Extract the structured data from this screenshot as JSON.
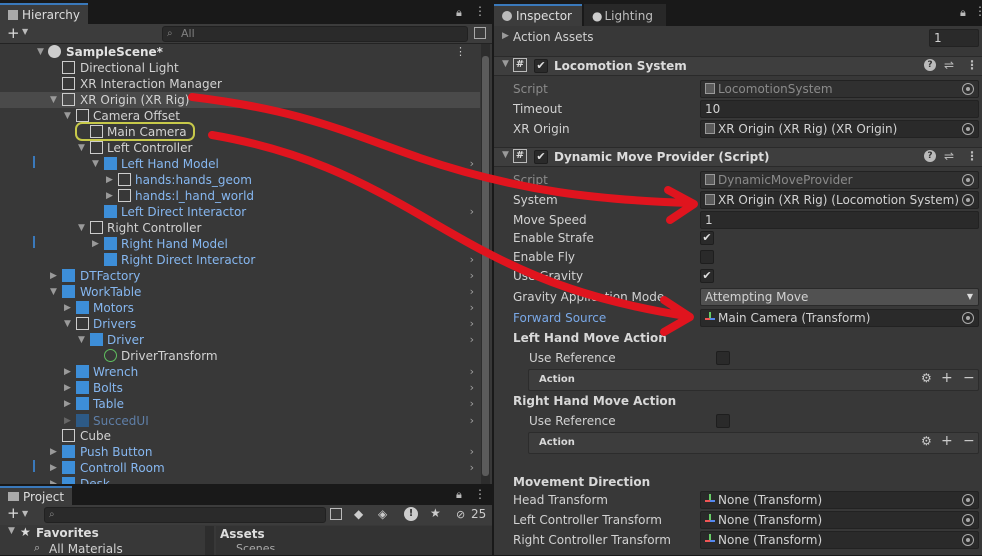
{
  "hierarchy": {
    "tab_label": "Hierarchy",
    "search_placeholder": "All",
    "add_label": "+",
    "items": [
      {
        "label": "SampleScene*",
        "depth": 0,
        "bold": true
      },
      {
        "label": "Directional Light"
      },
      {
        "label": "XR Interaction Manager"
      },
      {
        "label": "XR Origin (XR Rig)"
      },
      {
        "label": "Camera Offset"
      },
      {
        "label": "Main Camera"
      },
      {
        "label": "Left Controller"
      },
      {
        "label": "Left Hand Model"
      },
      {
        "label": "hands:hands_geom"
      },
      {
        "label": "hands:l_hand_world"
      },
      {
        "label": "Left Direct Interactor"
      },
      {
        "label": "Right Controller"
      },
      {
        "label": "Right Hand Model"
      },
      {
        "label": "Right Direct Interactor"
      },
      {
        "label": "DTFactory"
      },
      {
        "label": "WorkTable"
      },
      {
        "label": "Motors"
      },
      {
        "label": "Drivers"
      },
      {
        "label": "Driver"
      },
      {
        "label": "DriverTransform"
      },
      {
        "label": "Wrench"
      },
      {
        "label": "Bolts"
      },
      {
        "label": "Table"
      },
      {
        "label": "SuccedUI"
      },
      {
        "label": "Cube"
      },
      {
        "label": "Push Button"
      },
      {
        "label": "Controll Room"
      },
      {
        "label": "Desk"
      }
    ]
  },
  "project": {
    "tab_label": "Project",
    "add_label": "+",
    "hidden_count": "25",
    "favorites_label": "Favorites",
    "all_materials": "All Materials",
    "assets_label": "Assets",
    "scenes_label": "Scenes"
  },
  "inspector": {
    "tab_label": "Inspector",
    "lighting_tab_label": "Lighting",
    "action_assets_label": "Action Assets",
    "action_assets_value": "1",
    "locomotion": {
      "title": "Locomotion System",
      "script_label": "Script",
      "script_value": "LocomotionSystem",
      "timeout_label": "Timeout",
      "timeout_value": "10",
      "xr_origin_label": "XR Origin",
      "xr_origin_value": "XR Origin (XR Rig) (XR Origin)"
    },
    "move_provider": {
      "title": "Dynamic Move Provider (Script)",
      "script_label": "Script",
      "script_value": "DynamicMoveProvider",
      "system_label": "System",
      "system_value": "XR Origin (XR Rig) (Locomotion System)",
      "move_speed_label": "Move Speed",
      "move_speed_value": "1",
      "enable_strafe_label": "Enable Strafe",
      "enable_fly_label": "Enable Fly",
      "use_gravity_label": "Use Gravity",
      "gravity_mode_label": "Gravity Application Mode",
      "gravity_mode_value": "Attempting Move",
      "forward_source_label": "Forward Source",
      "forward_source_value": "Main Camera (Transform)",
      "left_action_label": "Left Hand Move Action",
      "right_action_label": "Right Hand Move Action",
      "use_reference_label": "Use Reference",
      "action_label": "Action",
      "movement_direction_label": "Movement Direction",
      "head_transform_label": "Head Transform",
      "left_controller_transform_label": "Left Controller Transform",
      "right_controller_transform_label": "Right Controller Transform",
      "none_transform": "None (Transform)"
    }
  },
  "colors": {
    "accent": "#3a79bb",
    "annotation": "#e0141e",
    "highlight": "#c7c94a"
  }
}
